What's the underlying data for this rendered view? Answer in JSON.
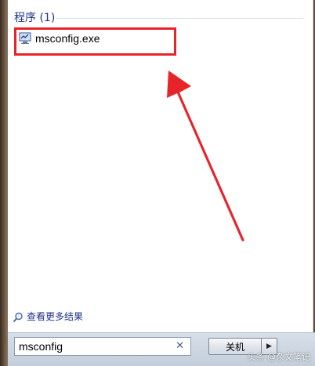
{
  "results": {
    "section_header": "程序 (1)",
    "items": [
      {
        "label": "msconfig.exe",
        "icon": "msconfig-app-icon"
      }
    ]
  },
  "see_more": {
    "label": "查看更多结果",
    "icon": "search-icon"
  },
  "search": {
    "value": "msconfig",
    "clear_icon": "close-icon"
  },
  "shutdown": {
    "label": "关机",
    "arrow_icon": "chevron-right-icon"
  },
  "watermark": {
    "text": "头条 @杂文笔记"
  },
  "colors": {
    "header_text": "#1e3287",
    "annotation_red": "#e8242b",
    "bottom_bar": "#d7dfe9"
  }
}
